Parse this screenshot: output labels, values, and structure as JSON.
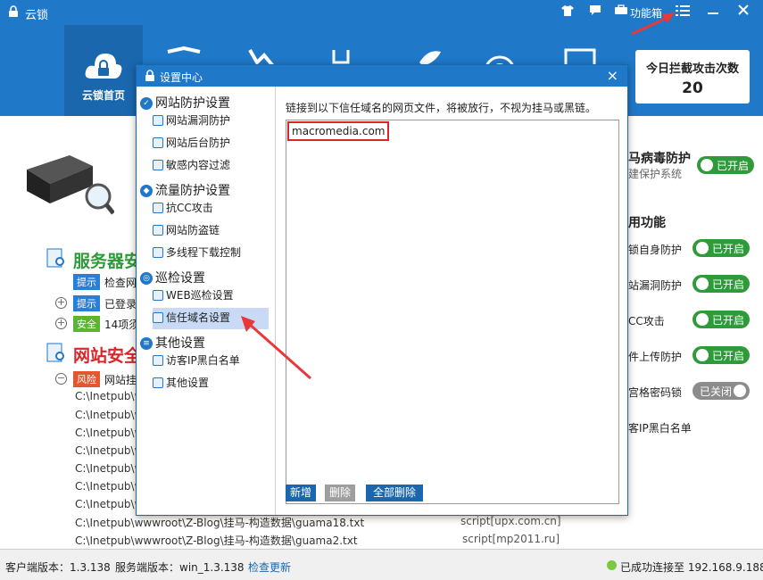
{
  "app": {
    "title": "云锁"
  },
  "titlebar": {
    "toolbox_label": "功能箱"
  },
  "nav": {
    "home_label": "云锁首页"
  },
  "counter": {
    "label": "今日拦截攻击次数",
    "value": "20"
  },
  "main": {
    "server_section_title": "服务器安",
    "tags": [
      {
        "text": "提示",
        "color": "#2a7fd4",
        "desc": "检查网"
      },
      {
        "text": "提示",
        "color": "#2a7fd4",
        "desc": "已登录"
      },
      {
        "text": "安全",
        "color": "#5cb531",
        "desc": "14项须"
      }
    ],
    "site_section_title": "网站安全",
    "risk": {
      "text": "风险",
      "color": "#e4572e",
      "desc": "网站挂"
    },
    "paths": [
      "C:\\Inetpub\\w",
      "C:\\Inetpub\\w",
      "C:\\Inetpub\\w",
      "C:\\Inetpub\\w",
      "C:\\Inetpub\\w",
      "C:\\Inetpub\\w",
      "C:\\Inetpub\\w",
      "C:\\Inetpub\\wwwroot\\Z-Blog\\挂马-构造数据\\guama18.txt",
      "C:\\Inetpub\\wwwroot\\Z-Blog\\挂马-构造数据\\guama2.txt"
    ],
    "scripts": [
      "script[upx.com.cn]",
      "script[mp2011.ru]"
    ]
  },
  "right_panel": {
    "virus_title": "马病毒防护",
    "virus_sub": "建保护系统",
    "common_title": "用功能",
    "features": [
      {
        "label": "锁自身防护",
        "state": "已开启",
        "on": true
      },
      {
        "label": "站漏洞防护",
        "state": "已开启",
        "on": true
      },
      {
        "label": "CC攻击",
        "state": "已开启",
        "on": true
      },
      {
        "label": "件上传防护",
        "state": "已开启",
        "on": true
      },
      {
        "label": "宫格密码锁",
        "state": "已关闭",
        "on": false
      }
    ],
    "virus_state": "已开启",
    "ip_blacklist": "客IP黑白名单"
  },
  "dialog": {
    "title": "设置中心",
    "close": "×",
    "groups": [
      {
        "label": "网站防护设置",
        "items": [
          "网站漏洞防护",
          "网站后台防护",
          "敏感内容过滤"
        ]
      },
      {
        "label": "流量防护设置",
        "items": [
          "抗CC攻击",
          "网站防盗链",
          "多线程下载控制"
        ]
      },
      {
        "label": "巡检设置",
        "items": [
          "WEB巡检设置",
          "信任域名设置"
        ]
      },
      {
        "label": "其他设置",
        "items": [
          "访客IP黑白名单",
          "其他设置"
        ]
      }
    ],
    "selected_item": "信任域名设置",
    "description": "链接到以下信任域名的网页文件，将被放行，不视为挂马或黑链。",
    "domains": [
      "macromedia.com"
    ],
    "buttons": {
      "add": "新增",
      "delete": "删除",
      "delete_all": "全部删除"
    }
  },
  "status": {
    "client_version": "客户端版本：1.3.138",
    "server_version": "服务端版本：win_1.3.138",
    "check_update": "检查更新",
    "connection": "已成功连接至 192.168.9.188"
  },
  "colors": {
    "brand_blue": "#1f78c8",
    "toggle_on": "#2e9a3a",
    "toggle_off": "#8c8c8c",
    "highlight_red": "#d9262a"
  }
}
